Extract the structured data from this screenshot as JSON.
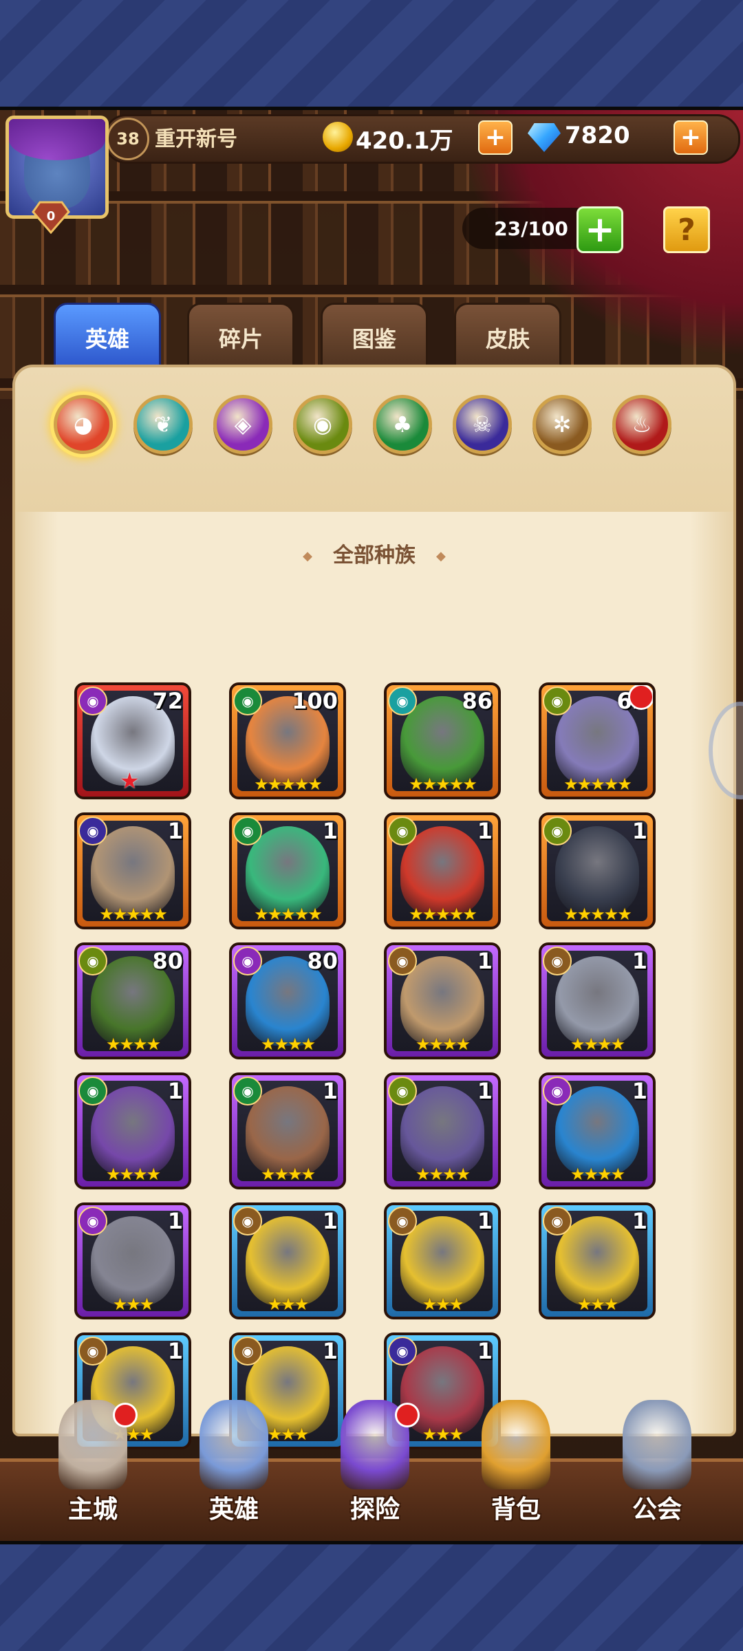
{
  "player": {
    "level": "38",
    "name": "重开新号",
    "avatar_level": "0"
  },
  "currency": {
    "gold": "420.1万",
    "gems": "7820",
    "plus": "+"
  },
  "hero_capacity": "23/100",
  "capacity_plus": "+",
  "help_icon": "?",
  "tabs": [
    {
      "label": "英雄",
      "active": true
    },
    {
      "label": "碎片",
      "active": false
    },
    {
      "label": "图鉴",
      "active": false
    },
    {
      "label": "皮肤",
      "active": false
    }
  ],
  "race_filter_label": "全部种族",
  "race_filters": [
    {
      "icon": "all-races-icon",
      "color": "#e0452a",
      "selected": true
    },
    {
      "icon": "wind-race-icon",
      "color": "#1aa0a0"
    },
    {
      "icon": "arcane-race-icon",
      "color": "#8a2ab8"
    },
    {
      "icon": "eye-race-icon",
      "color": "#6a8a10"
    },
    {
      "icon": "nature-race-icon",
      "color": "#1a8a3a"
    },
    {
      "icon": "undead-race-icon",
      "color": "#3a2a9a"
    },
    {
      "icon": "light-race-icon",
      "color": "#8a5a20"
    },
    {
      "icon": "fire-race-icon",
      "color": "#b01a1a"
    }
  ],
  "heroes": [
    {
      "level": "72",
      "frame": "red",
      "faction_color": "#8a2ab8",
      "art": "#d8e0f0",
      "stars": "",
      "red_star": "★"
    },
    {
      "level": "100",
      "frame": "orange",
      "faction_color": "#1a8a3a",
      "art": "#f08a40",
      "stars": "★★★★★"
    },
    {
      "level": "86",
      "frame": "orange",
      "faction_color": "#1aa0a0",
      "art": "#4aa03a",
      "stars": "★★★★★"
    },
    {
      "level": "62",
      "frame": "orange",
      "faction_color": "#6a8a10",
      "art": "#8a80c0",
      "stars": "★★★★★",
      "notify": true
    },
    {
      "level": "1",
      "frame": "orange",
      "faction_color": "#3a2a9a",
      "art": "#b89a78",
      "stars": "★★★★★"
    },
    {
      "level": "1",
      "frame": "orange",
      "faction_color": "#1a8a3a",
      "art": "#3ac080",
      "stars": "★★★★★"
    },
    {
      "level": "1",
      "frame": "orange",
      "faction_color": "#6a8a10",
      "art": "#d83a2a",
      "stars": "★★★★★"
    },
    {
      "level": "1",
      "frame": "orange",
      "faction_color": "#6a8a10",
      "art": "#3a4050",
      "stars": "★★★★★"
    },
    {
      "level": "80",
      "frame": "purple",
      "faction_color": "#6a8a10",
      "art": "#4a7a2a",
      "stars": "★★★★"
    },
    {
      "level": "80",
      "frame": "purple",
      "faction_color": "#8a2ab8",
      "art": "#2a8ad8",
      "stars": "★★★★"
    },
    {
      "level": "1",
      "frame": "purple",
      "faction_color": "#8a5a20",
      "art": "#c8a070",
      "stars": "★★★★"
    },
    {
      "level": "1",
      "frame": "purple",
      "faction_color": "#8a5a20",
      "art": "#9aa0b0",
      "stars": "★★★★"
    },
    {
      "level": "1",
      "frame": "purple",
      "faction_color": "#1a8a3a",
      "art": "#7a4ab0",
      "stars": "★★★★"
    },
    {
      "level": "1",
      "frame": "purple",
      "faction_color": "#1a8a3a",
      "art": "#a06a4a",
      "stars": "★★★★"
    },
    {
      "level": "1",
      "frame": "purple",
      "faction_color": "#6a8a10",
      "art": "#6a5aa0",
      "stars": "★★★★"
    },
    {
      "level": "1",
      "frame": "purple",
      "faction_color": "#8a2ab8",
      "art": "#2a8ad8",
      "stars": "★★★★"
    },
    {
      "level": "1",
      "frame": "purple",
      "faction_color": "#8a2ab8",
      "art": "#8a8a98",
      "stars": "★★★"
    },
    {
      "level": "1",
      "frame": "blue",
      "faction_color": "#8a5a20",
      "art": "#f0c830",
      "stars": "★★★"
    },
    {
      "level": "1",
      "frame": "blue",
      "faction_color": "#8a5a20",
      "art": "#f0c830",
      "stars": "★★★"
    },
    {
      "level": "1",
      "frame": "blue",
      "faction_color": "#8a5a20",
      "art": "#f0c830",
      "stars": "★★★"
    },
    {
      "level": "1",
      "frame": "blue",
      "faction_color": "#8a5a20",
      "art": "#f0c830",
      "stars": "★★★"
    },
    {
      "level": "1",
      "frame": "blue",
      "faction_color": "#8a5a20",
      "art": "#f0c830",
      "stars": "★★★"
    },
    {
      "level": "1",
      "frame": "blue",
      "faction_color": "#3a2a9a",
      "art": "#b03a4a",
      "stars": "★★★"
    }
  ],
  "bottom_nav": [
    {
      "label": "主城",
      "icon": "castle-icon",
      "color": "#c0b0a0",
      "notify": true
    },
    {
      "label": "英雄",
      "icon": "hero-icon",
      "color": "#7a9ad8",
      "notify": false
    },
    {
      "label": "探险",
      "icon": "portal-icon",
      "color": "#7a4ad0",
      "notify": true
    },
    {
      "label": "背包",
      "icon": "backpack-icon",
      "color": "#e0a030",
      "notify": false
    },
    {
      "label": "公会",
      "icon": "guild-tower-icon",
      "color": "#8a9ab8",
      "notify": false
    }
  ]
}
